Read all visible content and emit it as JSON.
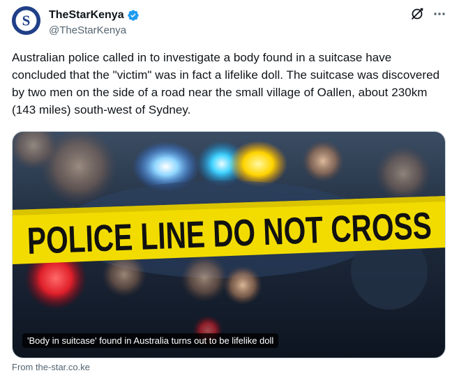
{
  "author": {
    "display_name": "TheStarKenya",
    "handle": "@TheStarKenya",
    "avatar_letter": "S",
    "verified": true
  },
  "tweet": {
    "text": "Australian police called in to investigate a body found in a suitcase have concluded that the \"victim\" was in fact a lifelike doll. The suitcase was discovered by two men on the side of a road near the small village of Oallen, about 230km (143 miles) south-west of Sydney."
  },
  "card": {
    "image_text": "POLICE LINE DO NOT CROSS",
    "headline": "'Body in suitcase' found in Australia turns out to be lifelike doll",
    "source": "From the-star.co.ke"
  },
  "icons": {
    "grok": "grok-icon",
    "more": "more-icon",
    "verified": "verified-badge-icon"
  },
  "colors": {
    "verified_blue": "#1d9bf0",
    "avatar_bg": "#1f3f87",
    "tape_yellow": "#f5e100",
    "secondary_text": "#536471"
  }
}
